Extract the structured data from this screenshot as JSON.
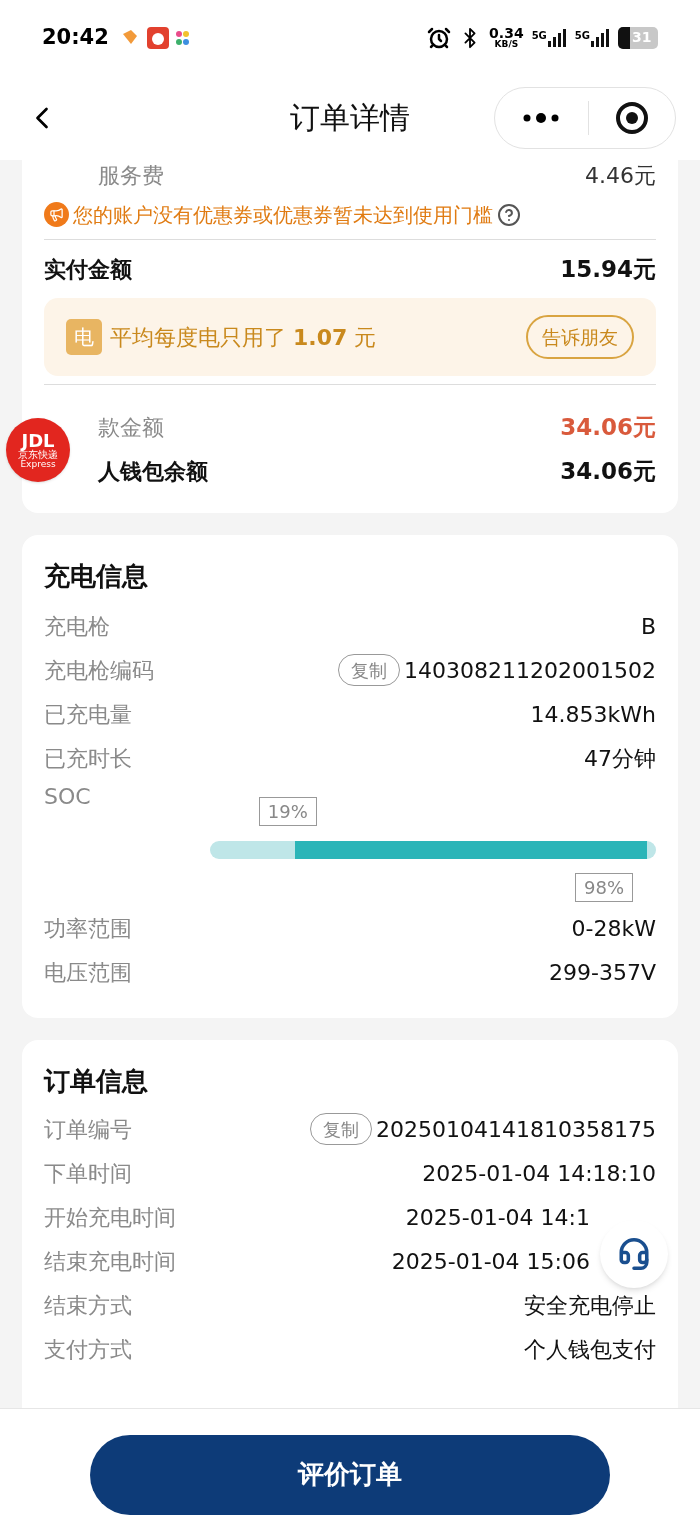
{
  "status_bar": {
    "time": "20:42",
    "net_speed": "0.34",
    "net_unit": "KB/S",
    "signals": [
      "5G",
      "5G"
    ],
    "battery": "31"
  },
  "nav": {
    "title": "订单详情"
  },
  "payment": {
    "fee_label": "服务费",
    "fee_value": "4.46元",
    "coupon_notice": "您的账户没有优惠券或优惠券暂未达到使用门槛",
    "paid_label": "实付金额",
    "paid_value": "15.94元",
    "avg_badge": "电",
    "avg_text": "平均每度电只用了 **1.07** 元",
    "share_button": "告诉朋友",
    "rows": [
      {
        "label": "款金额",
        "value": "34.06元",
        "kind": "refund"
      },
      {
        "label": "人钱包余额",
        "value": "34.06元",
        "kind": "balance"
      }
    ]
  },
  "floating_badge": {
    "logo": "JDL",
    "name": "京东快递",
    "sub": "Express"
  },
  "charging": {
    "title": "充电信息",
    "rows": [
      {
        "label": "充电枪",
        "value": "B",
        "kind": "plain"
      },
      {
        "label": "充电枪编码",
        "value": "140308211202001502",
        "kind": "copy",
        "copy_label": "复制"
      },
      {
        "label": "已充电量",
        "value": "14.853kWh",
        "kind": "plain"
      },
      {
        "label": "已充时长",
        "value": "47分钟",
        "kind": "plain"
      }
    ],
    "soc": {
      "label": "SOC",
      "start_label": "19%",
      "end_label": "98%"
    },
    "rows_after": [
      {
        "label": "功率范围",
        "value": "0-28kW"
      },
      {
        "label": "电压范围",
        "value": "299-357V"
      }
    ]
  },
  "order": {
    "title": "订单信息",
    "rows": [
      {
        "label": "订单编号",
        "value": "20250104141810358175",
        "kind": "copy",
        "copy_label": "复制"
      },
      {
        "label": "下单时间",
        "value": "2025-01-04 14:18:10",
        "kind": "plain"
      },
      {
        "label": "开始充电时间",
        "value": "2025-01-04 14:1",
        "kind": "covered"
      },
      {
        "label": "结束充电时间",
        "value": "2025-01-04 15:06",
        "kind": "covered"
      },
      {
        "label": "结束方式",
        "value": "安全充电停止",
        "kind": "plain"
      },
      {
        "label": "支付方式",
        "value": "个人钱包支付",
        "kind": "plain"
      }
    ]
  },
  "bottom": {
    "button": "评价订单"
  }
}
